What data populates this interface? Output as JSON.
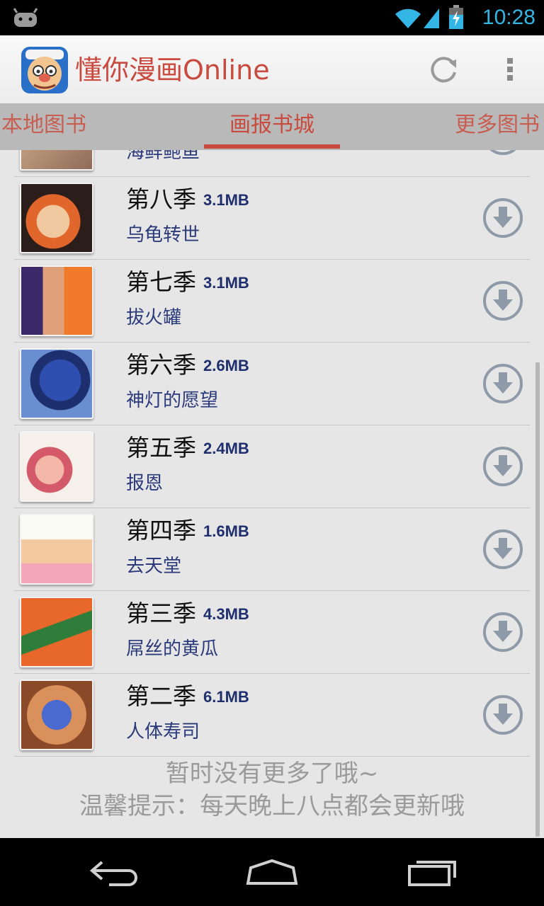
{
  "status_bar": {
    "time": "10:28"
  },
  "app": {
    "title": "懂你漫画Online"
  },
  "tabs": [
    {
      "label": "本地图书"
    },
    {
      "label": "画报书城"
    },
    {
      "label": "更多图书"
    }
  ],
  "partial_row": {
    "subtitle": "海鲜鲍鱼"
  },
  "items": [
    {
      "season": "第八季",
      "size": "3.1MB",
      "subtitle": "乌龟转世"
    },
    {
      "season": "第七季",
      "size": "3.1MB",
      "subtitle": "拔火罐"
    },
    {
      "season": "第六季",
      "size": "2.6MB",
      "subtitle": "神灯的愿望"
    },
    {
      "season": "第五季",
      "size": "2.4MB",
      "subtitle": "报恩"
    },
    {
      "season": "第四季",
      "size": "1.6MB",
      "subtitle": "去天堂"
    },
    {
      "season": "第三季",
      "size": "4.3MB",
      "subtitle": "屌丝的黄瓜"
    },
    {
      "season": "第二季",
      "size": "6.1MB",
      "subtitle": "人体寿司"
    }
  ],
  "footer": {
    "line1": "暂时没有更多了哦~",
    "line2": "温馨提示：每天晚上八点都会更新哦"
  },
  "icons": {
    "refresh": "refresh-icon",
    "overflow": "overflow-menu-icon",
    "download": "download-icon"
  },
  "colors": {
    "accent": "#c94a3e",
    "status_time": "#33b5e5"
  }
}
